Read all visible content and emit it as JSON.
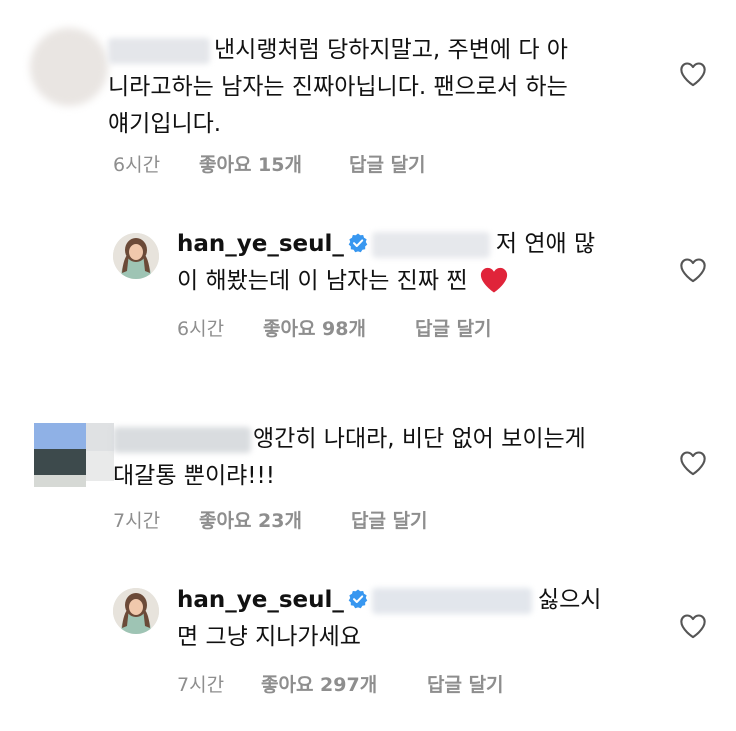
{
  "comments": [
    {
      "text_l1": "낸시랭처럼 당하지말고, 주변에 다 아",
      "text_l2": "니라고하는 남자는 진짜아닙니다. 팬으로서 하는",
      "text_l3": "얘기입니다.",
      "time": "6시간",
      "likes": "좋아요 15개",
      "reply": "답글 달기"
    },
    {
      "username": "han_ye_seul_",
      "text_l1": "저 연애 많",
      "text_l2": "이 해봤는데 이 남자는 진짜 찐",
      "time": "6시간",
      "likes": "좋아요 98개",
      "reply": "답글 달기"
    },
    {
      "text_l1": "앵간히 나대라, 비단 없어 보이는게",
      "text_l2": "대갈통 뿐이랴!!!",
      "time": "7시간",
      "likes": "좋아요 23개",
      "reply": "답글 달기"
    },
    {
      "username": "han_ye_seul_",
      "text_l1": "싫으시",
      "text_l2": "면 그냥 지나가세요",
      "time": "7시간",
      "likes": "좋아요 297개",
      "reply": "답글 달기"
    }
  ],
  "icons": {
    "heart": "heart-outline-icon",
    "verified": "verified-badge-icon",
    "emoji": "red-heart-emoji"
  },
  "colors": {
    "meta_text": "#8e8e8e",
    "verified_blue": "#3897f0",
    "heart_red": "#e0243a"
  }
}
